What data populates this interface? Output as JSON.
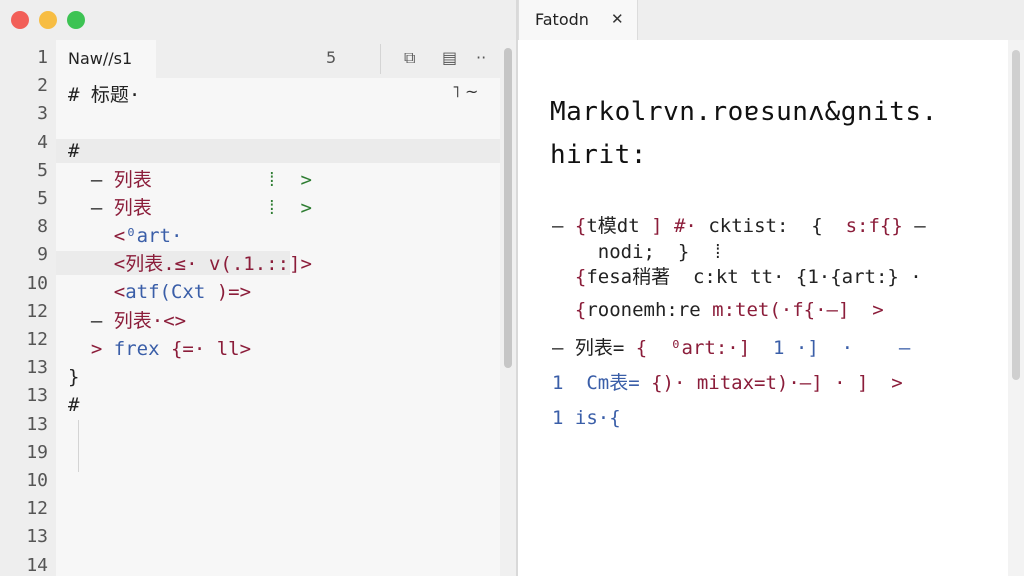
{
  "window": {
    "traffic_lights": [
      "close-button",
      "minimize-button",
      "maximize-button"
    ],
    "colors": {
      "close": "#f25f58",
      "minimize": "#f7bd43",
      "maximize": "#3dc353"
    }
  },
  "preview_tab": {
    "label": "Fatodn",
    "close": "✕"
  },
  "editor": {
    "tab_label": "Naw//s1",
    "toolbar": {
      "marker": "5",
      "split": "⧉",
      "preview": "▤",
      "more": "··"
    },
    "corner_mark": "˥ ~",
    "line_numbers": [
      "1",
      "2",
      "3",
      "4",
      "5",
      "5",
      "8",
      "9",
      "10",
      "12",
      "12",
      "13",
      "13",
      "13",
      "19",
      "10",
      "12",
      "13",
      "14"
    ],
    "lines": [
      {
        "parts": [
          {
            "t": "# 标题·",
            "c": "k"
          }
        ]
      },
      {
        "parts": []
      },
      {
        "parts": [
          {
            "t": "#",
            "c": "k"
          }
        ]
      },
      {
        "parts": [
          {
            "t": "  – ",
            "c": "k"
          },
          {
            "t": "列表",
            "c": "m"
          },
          {
            "t": "          ⁞  ",
            "c": "g"
          },
          {
            "t": ">",
            "c": "g"
          }
        ]
      },
      {
        "parts": [
          {
            "t": "  – ",
            "c": "k"
          },
          {
            "t": "列表",
            "c": "m"
          },
          {
            "t": "          ⁞  ",
            "c": "g"
          },
          {
            "t": ">",
            "c": "g"
          }
        ]
      },
      {
        "parts": [
          {
            "t": "    <",
            "c": "m"
          },
          {
            "t": "⁰art·",
            "c": "b"
          }
        ]
      },
      {
        "parts": [
          {
            "t": "    <",
            "c": "m"
          },
          {
            "t": "列表.≤· v(.1.:",
            "c": "m"
          },
          {
            "t": ":]>",
            "c": "m"
          }
        ]
      },
      {
        "parts": [
          {
            "t": "    <",
            "c": "m"
          },
          {
            "t": "atf(Cxt",
            "c": "b"
          },
          {
            "t": " )=>",
            "c": "m"
          }
        ]
      },
      {
        "parts": [
          {
            "t": "  – ",
            "c": "k"
          },
          {
            "t": "列表·<>",
            "c": "m"
          }
        ]
      },
      {
        "parts": [
          {
            "t": "  > ",
            "c": "m"
          },
          {
            "t": "frex",
            "c": "b"
          },
          {
            "t": " {=· ll>",
            "c": "m"
          }
        ]
      },
      {
        "parts": [
          {
            "t": "}",
            "c": "k"
          }
        ]
      },
      {
        "parts": [
          {
            "t": "#",
            "c": "k"
          }
        ]
      }
    ]
  },
  "preview": {
    "title_line1": "Markolrvn.roɐsunʌ&gnits.",
    "title_line2": "hirit:",
    "lines": [
      {
        "parts": [
          {
            "t": "– ",
            "c": "k"
          },
          {
            "t": "{",
            "c": "m"
          },
          {
            "t": "t模dt",
            "c": "k"
          },
          {
            "t": " ] #· ",
            "c": "m"
          },
          {
            "t": "ckti",
            "c": "k"
          },
          {
            "t": "st:  {  ",
            "c": "k"
          },
          {
            "t": "s:f{}",
            "c": "m"
          },
          {
            "t": " –",
            "c": "k"
          }
        ]
      },
      {
        "parts": [
          {
            "t": "    nodi;  }  ⁞",
            "c": "k"
          }
        ]
      },
      {
        "parts": [
          {
            "t": "  {",
            "c": "m"
          },
          {
            "t": "fesa稍著",
            "c": "k"
          },
          {
            "t": "  c:kt tt· {1·{art:} ·",
            "c": "k"
          }
        ]
      },
      {
        "parts": [
          {
            "t": "  {",
            "c": "m"
          },
          {
            "t": "roonemh:re",
            "c": "k"
          },
          {
            "t": " m:tet(·f{·–]  >",
            "c": "m"
          }
        ]
      },
      {
        "parts": [
          {
            "t": "– 列表= ",
            "c": "k"
          },
          {
            "t": "{  ⁰art:·]",
            "c": "m"
          },
          {
            "t": "  1 ·]  ·    –",
            "c": "b"
          }
        ]
      },
      {
        "parts": [
          {
            "t": "1  Cm表= ",
            "c": "b"
          },
          {
            "t": "{)· mitax=t)·–] · ]  >",
            "c": "m"
          }
        ]
      },
      {
        "parts": [
          {
            "t": "1 is·{",
            "c": "b"
          }
        ]
      }
    ]
  }
}
